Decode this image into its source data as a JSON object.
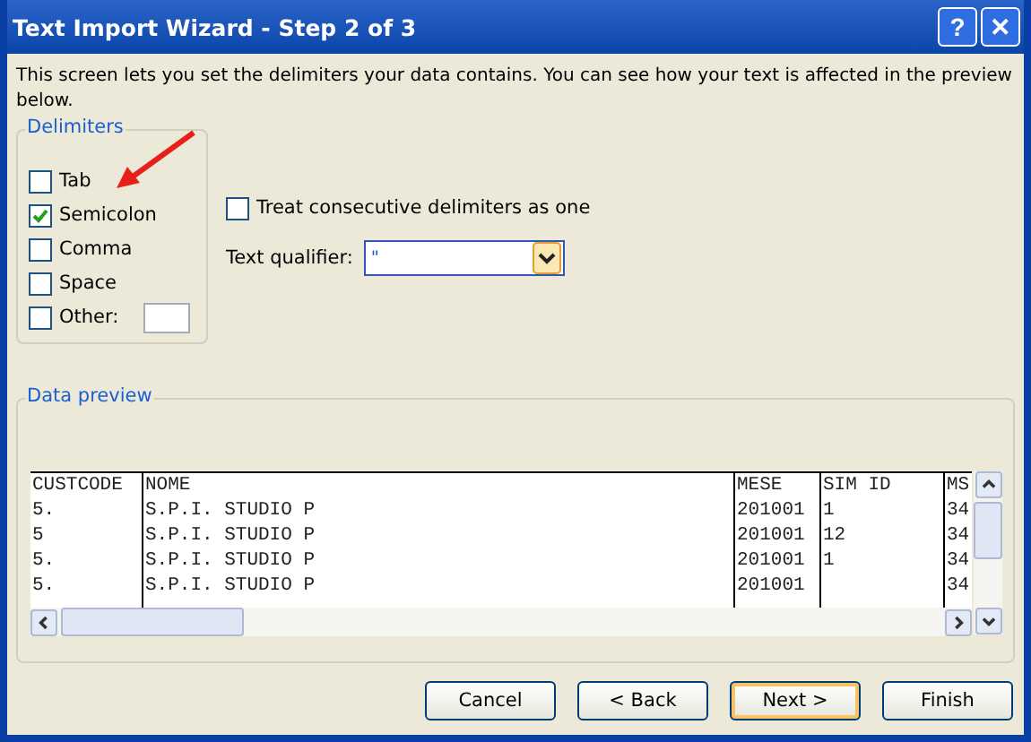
{
  "window": {
    "title": "Text Import Wizard - Step 2 of 3",
    "help": "?",
    "close": "✕"
  },
  "intro": "This screen lets you set the delimiters your data contains.  You can see how your text is affected in the preview below.",
  "delimiters": {
    "title": "Delimiters",
    "items": [
      {
        "label": "Tab",
        "checked": false
      },
      {
        "label": "Semicolon",
        "checked": true
      },
      {
        "label": "Comma",
        "checked": false
      },
      {
        "label": "Space",
        "checked": false
      },
      {
        "label": "Other:",
        "checked": false,
        "kind": "field"
      }
    ]
  },
  "consecutive": {
    "label": "Treat consecutive delimiters as one",
    "checked": false
  },
  "qualifier": {
    "label": "Text qualifier:",
    "value": "\""
  },
  "preview": {
    "title": "Data preview",
    "columns": [
      "CUSTCODE",
      "NOME",
      "MESE",
      "SIM ID",
      "MS"
    ],
    "rows": [
      [
        "5.",
        "S.P.I. STUDIO P",
        "201001",
        "1",
        "34"
      ],
      [
        "5",
        "S.P.I. STUDIO P",
        "201001",
        "12",
        "34"
      ],
      [
        "5.",
        "S.P.I. STUDIO P",
        "201001",
        "1",
        "34"
      ],
      [
        "5.",
        "S.P.I. STUDIO P",
        "201001",
        "",
        "34"
      ]
    ]
  },
  "buttons": [
    {
      "label": "Cancel",
      "selected": false
    },
    {
      "label": "< Back",
      "selected": false
    },
    {
      "label": "Next >",
      "selected": true
    },
    {
      "label": "Finish",
      "selected": false
    }
  ]
}
